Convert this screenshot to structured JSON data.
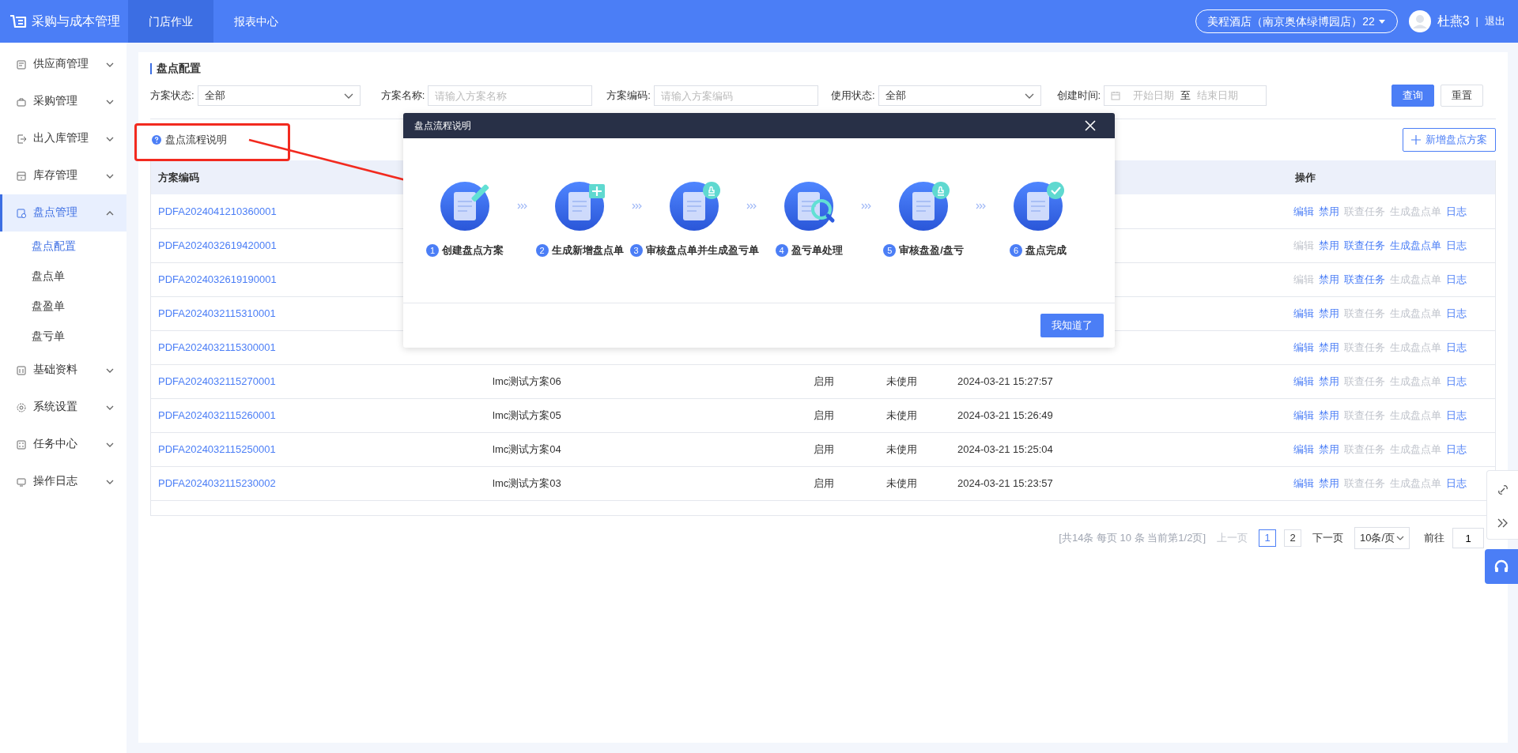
{
  "topbar": {
    "app_title": "采购与成本管理",
    "tabs": [
      {
        "label": "门店作业",
        "selected": true
      },
      {
        "label": "报表中心",
        "selected": false
      }
    ],
    "store": "美程酒店（南京奥体绿博园店）22",
    "user": "杜燕3",
    "separator": "|",
    "logout": "退出"
  },
  "sidebar": {
    "items": [
      {
        "label": "供应商管理",
        "expanded": false,
        "selected": false
      },
      {
        "label": "采购管理",
        "expanded": false,
        "selected": false
      },
      {
        "label": "出入库管理",
        "expanded": false,
        "selected": false
      },
      {
        "label": "库存管理",
        "expanded": false,
        "selected": false
      },
      {
        "label": "盘点管理",
        "expanded": true,
        "selected": true,
        "children": [
          {
            "label": "盘点配置",
            "selected": true
          },
          {
            "label": "盘点单",
            "selected": false
          },
          {
            "label": "盘盈单",
            "selected": false
          },
          {
            "label": "盘亏单",
            "selected": false
          }
        ]
      },
      {
        "label": "基础资料",
        "expanded": false,
        "selected": false
      },
      {
        "label": "系统设置",
        "expanded": false,
        "selected": false
      },
      {
        "label": "任务中心",
        "expanded": false,
        "selected": false
      },
      {
        "label": "操作日志",
        "expanded": false,
        "selected": false
      }
    ]
  },
  "page": {
    "title": "盘点配置"
  },
  "filters": [
    {
      "kind": "select",
      "label": "方案状态:",
      "value": "全部"
    },
    {
      "kind": "input",
      "label": "方案名称:",
      "placeholder": "请输入方案名称"
    },
    {
      "kind": "input",
      "label": "方案编码:",
      "placeholder": "请输入方案编码"
    },
    {
      "kind": "select",
      "label": "使用状态:",
      "value": "全部"
    },
    {
      "kind": "daterange",
      "label": "创建时间:",
      "start_placeholder": "开始日期",
      "separator": "至",
      "end_placeholder": "结束日期"
    }
  ],
  "filter_buttons": [
    {
      "label": "查询",
      "primary": true
    },
    {
      "label": "重置",
      "primary": false
    }
  ],
  "help_link": "盘点流程说明",
  "add_button": "新增盘点方案",
  "table": {
    "columns": [
      "方案编码",
      "操作"
    ],
    "rows": [
      {
        "code": "PDFA2024041210360001",
        "actions": [
          {
            "label": "编辑",
            "disabled": false
          },
          {
            "label": "禁用",
            "disabled": false
          },
          {
            "label": "联查任务",
            "disabled": true
          },
          {
            "label": "生成盘点单",
            "disabled": true
          },
          {
            "label": "日志",
            "disabled": false
          }
        ]
      },
      {
        "code": "PDFA2024032619420001",
        "actions": [
          {
            "label": "编辑",
            "disabled": true
          },
          {
            "label": "禁用",
            "disabled": false
          },
          {
            "label": "联查任务",
            "disabled": false
          },
          {
            "label": "生成盘点单",
            "disabled": false
          },
          {
            "label": "日志",
            "disabled": false
          }
        ]
      },
      {
        "code": "PDFA2024032619190001",
        "actions": [
          {
            "label": "编辑",
            "disabled": true
          },
          {
            "label": "禁用",
            "disabled": false
          },
          {
            "label": "联查任务",
            "disabled": false
          },
          {
            "label": "生成盘点单",
            "disabled": true
          },
          {
            "label": "日志",
            "disabled": false
          }
        ]
      },
      {
        "code": "PDFA2024032115310001",
        "actions": [
          {
            "label": "编辑",
            "disabled": false
          },
          {
            "label": "禁用",
            "disabled": false
          },
          {
            "label": "联查任务",
            "disabled": true
          },
          {
            "label": "生成盘点单",
            "disabled": true
          },
          {
            "label": "日志",
            "disabled": false
          }
        ]
      },
      {
        "code": "PDFA2024032115300001",
        "actions": [
          {
            "label": "编辑",
            "disabled": false
          },
          {
            "label": "禁用",
            "disabled": false
          },
          {
            "label": "联查任务",
            "disabled": true
          },
          {
            "label": "生成盘点单",
            "disabled": true
          },
          {
            "label": "日志",
            "disabled": false
          }
        ]
      },
      {
        "code": "PDFA2024032115270001",
        "column_2": "lmc测试方案06",
        "column_3": "启用",
        "column_4": "未使用",
        "column_5": "2024-03-21 15:27:57",
        "actions": [
          {
            "label": "编辑",
            "disabled": false
          },
          {
            "label": "禁用",
            "disabled": false
          },
          {
            "label": "联查任务",
            "disabled": true
          },
          {
            "label": "生成盘点单",
            "disabled": true
          },
          {
            "label": "日志",
            "disabled": false
          }
        ]
      },
      {
        "code": "PDFA2024032115260001",
        "column_2": "lmc测试方案05",
        "column_3": "启用",
        "column_4": "未使用",
        "column_5": "2024-03-21 15:26:49",
        "actions": [
          {
            "label": "编辑",
            "disabled": false
          },
          {
            "label": "禁用",
            "disabled": false
          },
          {
            "label": "联查任务",
            "disabled": true
          },
          {
            "label": "生成盘点单",
            "disabled": true
          },
          {
            "label": "日志",
            "disabled": false
          }
        ]
      },
      {
        "code": "PDFA2024032115250001",
        "column_2": "lmc测试方案04",
        "column_3": "启用",
        "column_4": "未使用",
        "column_5": "2024-03-21 15:25:04",
        "actions": [
          {
            "label": "编辑",
            "disabled": false
          },
          {
            "label": "禁用",
            "disabled": false
          },
          {
            "label": "联查任务",
            "disabled": true
          },
          {
            "label": "生成盘点单",
            "disabled": true
          },
          {
            "label": "日志",
            "disabled": false
          }
        ]
      },
      {
        "code": "PDFA2024032115230002",
        "column_2": "lmc测试方案03",
        "column_3": "启用",
        "column_4": "未使用",
        "column_5": "2024-03-21 15:23:57",
        "actions": [
          {
            "label": "编辑",
            "disabled": false
          },
          {
            "label": "禁用",
            "disabled": false
          },
          {
            "label": "联查任务",
            "disabled": true
          },
          {
            "label": "生成盘点单",
            "disabled": true
          },
          {
            "label": "日志",
            "disabled": false
          }
        ]
      }
    ]
  },
  "pagination": {
    "summary": "[共14条 每页 10 条 当前第1/2页]",
    "prev": "上一页",
    "prev_disabled": true,
    "pages": [
      {
        "label": "1",
        "selected": true
      },
      {
        "label": "2",
        "selected": false
      }
    ],
    "next": "下一页",
    "page_size": "10条/页",
    "goto_label": "前往",
    "goto_value": "1"
  },
  "modal": {
    "title": "盘点流程说明",
    "steps": [
      {
        "number": "1",
        "label": "创建盘点方案",
        "kind": "pen"
      },
      {
        "number": "2",
        "label": "生成新增盘点单",
        "kind": "plus"
      },
      {
        "number": "3",
        "label": "审核盘点单并生成盈亏单",
        "kind": "stamp"
      },
      {
        "number": "4",
        "label": "盈亏单处理",
        "kind": "magnifier"
      },
      {
        "number": "5",
        "label": "审核盘盈/盘亏",
        "kind": "stamp"
      },
      {
        "number": "6",
        "label": "盘点完成",
        "kind": "check"
      }
    ],
    "confirm": "我知道了"
  },
  "annotation": {
    "kind": "box_with_arrow"
  }
}
